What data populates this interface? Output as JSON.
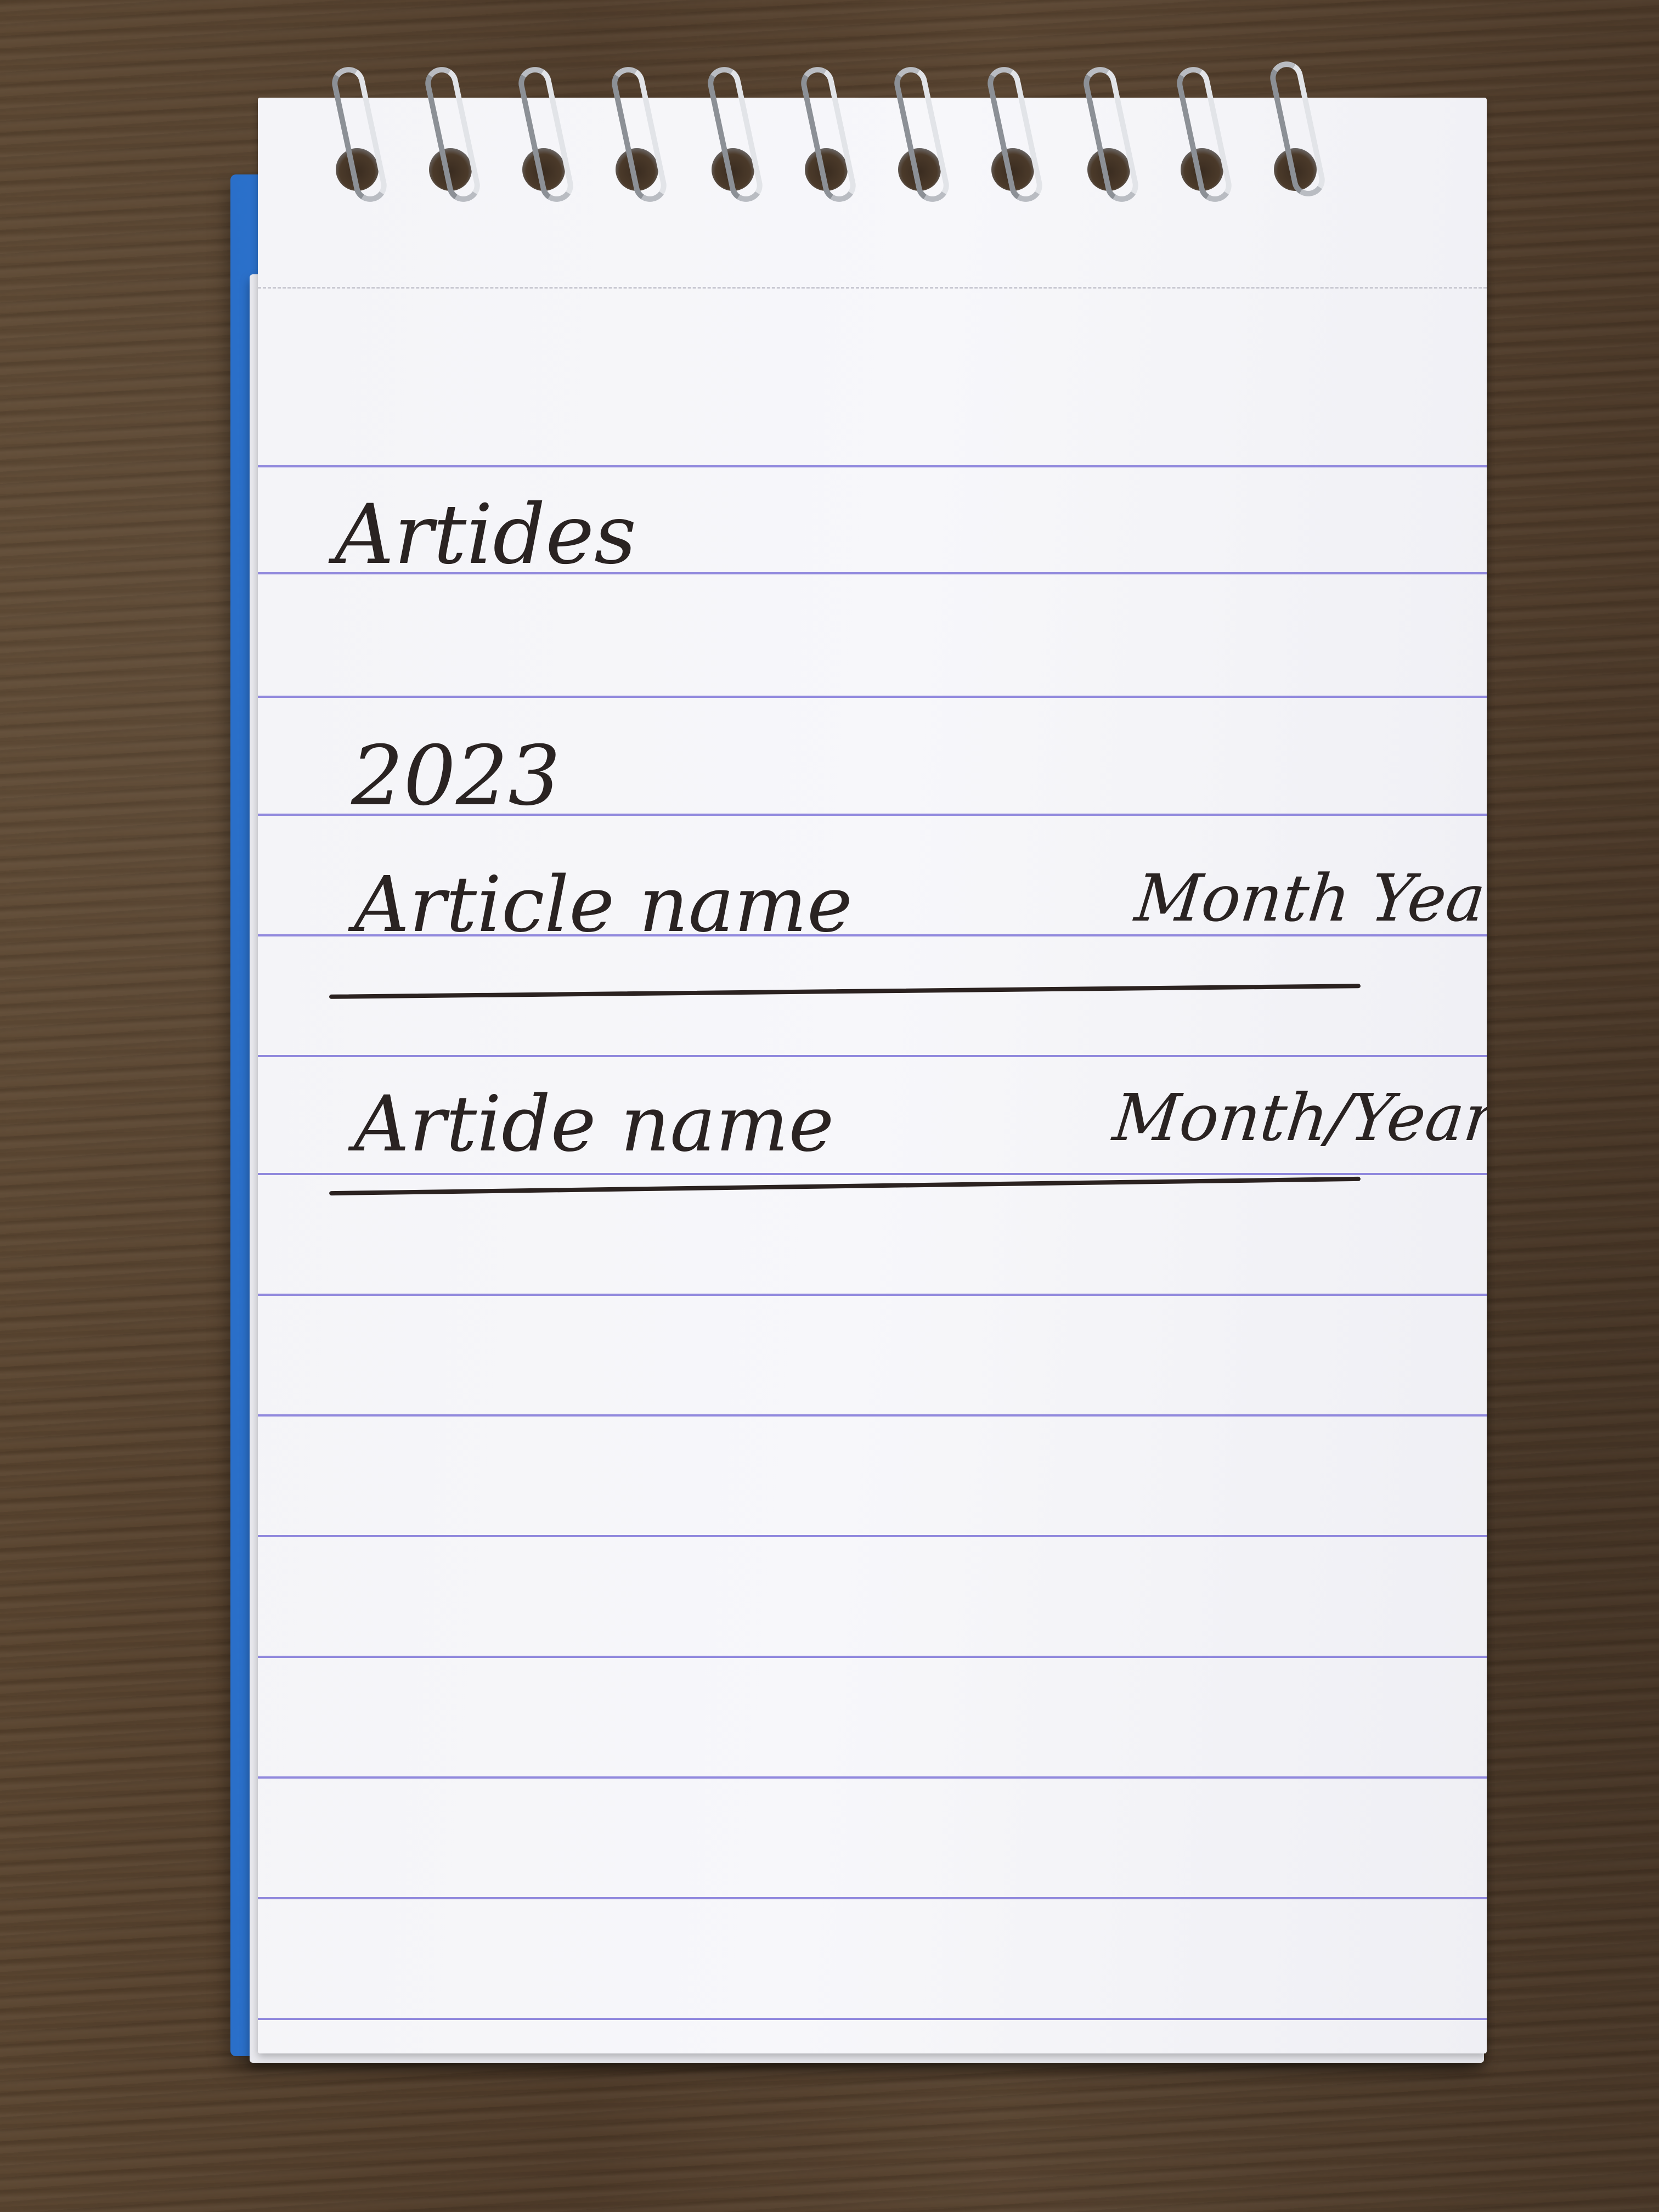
{
  "notebook": {
    "heading": "Artides",
    "year": "2023",
    "entries": [
      {
        "name": "Article name",
        "date": "Month Year"
      },
      {
        "name": "Artide name",
        "date": "Month/Year"
      }
    ]
  },
  "colors": {
    "cover": "#2f74cf",
    "paper": "#f4f4f8",
    "rule_line": "#7f76d8",
    "ink": "#2a2322",
    "table": "#54412f"
  }
}
